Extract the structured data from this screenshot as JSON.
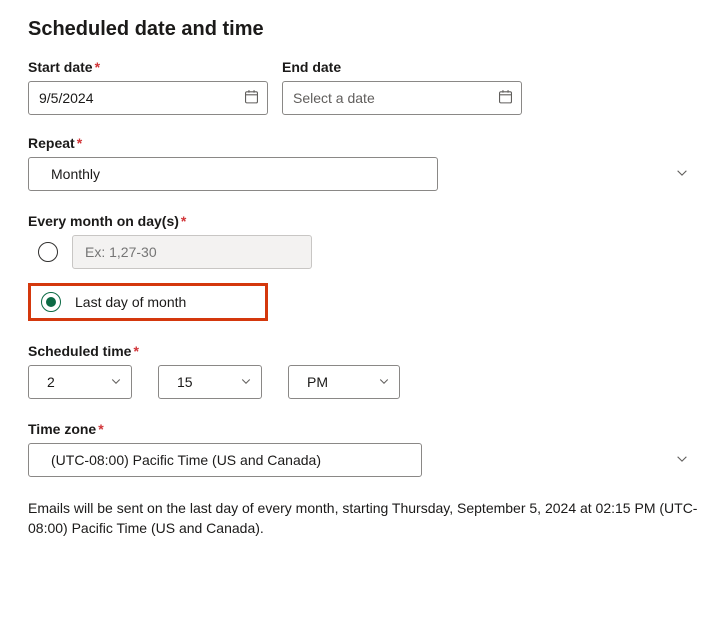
{
  "heading": "Scheduled date and time",
  "startDate": {
    "label": "Start date",
    "value": "9/5/2024",
    "required": true
  },
  "endDate": {
    "label": "End date",
    "placeholder": "Select a date",
    "required": false
  },
  "repeat": {
    "label": "Repeat",
    "value": "Monthly",
    "required": true
  },
  "monthDays": {
    "label": "Every month on day(s)",
    "required": true,
    "specificDays": {
      "placeholder": "Ex: 1,27-30",
      "selected": false
    },
    "lastDay": {
      "label": "Last day of month",
      "selected": true
    }
  },
  "scheduledTime": {
    "label": "Scheduled time",
    "required": true,
    "hour": "2",
    "minute": "15",
    "ampm": "PM"
  },
  "timeZone": {
    "label": "Time zone",
    "required": true,
    "value": "(UTC-08:00) Pacific Time (US and Canada)"
  },
  "summary": "Emails will be sent on the last day of every month, starting Thursday, September 5, 2024 at 02:15 PM (UTC-08:00) Pacific Time (US and Canada)."
}
